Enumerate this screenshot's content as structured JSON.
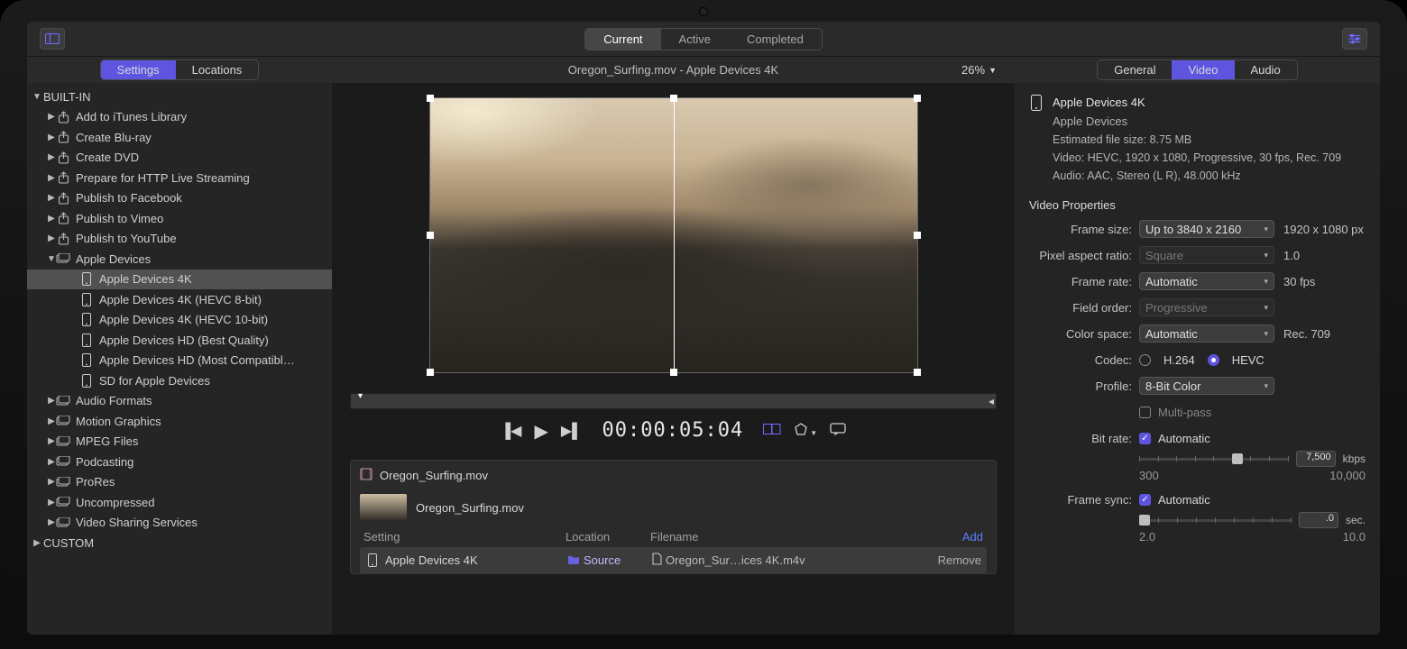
{
  "top_tabs": {
    "current": "Current",
    "active": "Active",
    "completed": "Completed"
  },
  "toolbar_icon": "sidebar-toggle-icon",
  "sidebar_tabs": {
    "settings": "Settings",
    "locations": "Locations"
  },
  "preview_title": "Oregon_Surfing.mov - Apple Devices 4K",
  "zoom": "26%",
  "inspector_tabs": {
    "general": "General",
    "video": "Video",
    "audio": "Audio"
  },
  "sidebar": {
    "builtin": "BUILT-IN",
    "custom": "CUSTOM",
    "items": [
      "Add to iTunes Library",
      "Create Blu-ray",
      "Create DVD",
      "Prepare for HTTP Live Streaming",
      "Publish to Facebook",
      "Publish to Vimeo",
      "Publish to YouTube"
    ],
    "apple_devices": "Apple Devices",
    "presets": [
      "Apple Devices 4K",
      "Apple Devices 4K (HEVC 8-bit)",
      "Apple Devices 4K (HEVC 10-bit)",
      "Apple Devices HD (Best Quality)",
      "Apple Devices HD (Most Compatibl…",
      "SD for Apple Devices"
    ],
    "groups": [
      "Audio Formats",
      "Motion Graphics",
      "MPEG Files",
      "Podcasting",
      "ProRes",
      "Uncompressed",
      "Video Sharing Services"
    ]
  },
  "timecode": "00:00:05:04",
  "batch": {
    "file": "Oregon_Surfing.mov",
    "clip": "Oregon_Surfing.mov",
    "headers": {
      "setting": "Setting",
      "location": "Location",
      "filename": "Filename",
      "add": "Add"
    },
    "row": {
      "setting": "Apple Devices 4K",
      "location": "Source",
      "filename": "Oregon_Sur…ices 4K.m4v",
      "remove": "Remove"
    }
  },
  "inspector": {
    "title": "Apple Devices 4K",
    "device": "Apple Devices",
    "filesize": "Estimated file size: 8.75 MB",
    "video": "Video: HEVC, 1920 x 1080, Progressive, 30 fps, Rec. 709",
    "audio": "Audio: AAC, Stereo (L R), 48.000 kHz",
    "section": "Video Properties",
    "labels": {
      "frame_size": "Frame size:",
      "par": "Pixel aspect ratio:",
      "frame_rate": "Frame rate:",
      "field_order": "Field order:",
      "color_space": "Color space:",
      "codec": "Codec:",
      "profile": "Profile:",
      "multipass": "Multi-pass",
      "bitrate": "Bit rate:",
      "automatic": "Automatic",
      "frame_sync": "Frame sync:"
    },
    "values": {
      "frame_size_sel": "Up to 3840 x 2160",
      "frame_size_out": "1920 x 1080 px",
      "par_sel": "Square",
      "par_out": "1.0",
      "frame_rate_sel": "Automatic",
      "frame_rate_out": "30 fps",
      "field_order_sel": "Progressive",
      "color_space_sel": "Automatic",
      "color_space_out": "Rec. 709",
      "codec_h264": "H.264",
      "codec_hevc": "HEVC",
      "profile_sel": "8-Bit Color",
      "bitrate_num": "7,500",
      "bitrate_unit": "kbps",
      "bitrate_min": "300",
      "bitrate_max": "10,000",
      "fs_num": ".0",
      "fs_unit": "sec.",
      "fs_min": "2.0",
      "fs_max": "10.0"
    }
  }
}
